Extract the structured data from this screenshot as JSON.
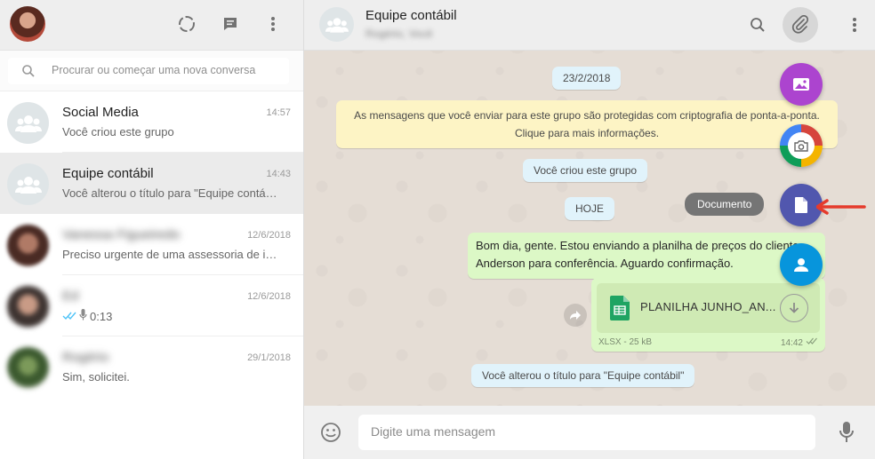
{
  "sidebar": {
    "search_placeholder": "Procurar ou começar uma nova conversa",
    "chats": [
      {
        "name": "Social Media",
        "time": "14:57",
        "preview": "Você criou este grupo"
      },
      {
        "name": "Equipe contábil",
        "time": "14:43",
        "preview": "Você alterou o título para \"Equipe contá…"
      },
      {
        "name": "Vanessa Figueiredo",
        "time": "12/6/2018",
        "preview": "Preciso urgente de uma assessoria de i…"
      },
      {
        "name": "Ed",
        "time": "12/6/2018",
        "preview": "0:13"
      },
      {
        "name": "Rogério",
        "time": "29/1/2018",
        "preview": "Sim, solicitei."
      }
    ]
  },
  "chat": {
    "title": "Equipe contábil",
    "members": "Rogério, Você",
    "date_label": "23/2/2018",
    "encryption_notice": "As mensagens que você enviar para este grupo são protegidas com criptografia de ponta-a-ponta. Clique para mais informações.",
    "created_notice": "Você criou este grupo",
    "today_label": "HOJE",
    "message_text": "Bom dia, gente. Estou enviando a planilha de preços do cliente Anderson para conferência. Aguardo confirmação.",
    "file": {
      "name": "PLANILHA JUNHO_AN...",
      "meta": "XLSX - 25 kB",
      "time": "14:42"
    },
    "rename_notice": "Você alterou o título para \"Equipe contábil\""
  },
  "attach_menu": {
    "tooltip": "Documento",
    "colors": {
      "gallery": "#ac44cf",
      "document": "#5157ae",
      "contact": "#0795dc",
      "arrow": "#e53b2c"
    }
  },
  "footer": {
    "placeholder": "Digite uma mensagem"
  }
}
